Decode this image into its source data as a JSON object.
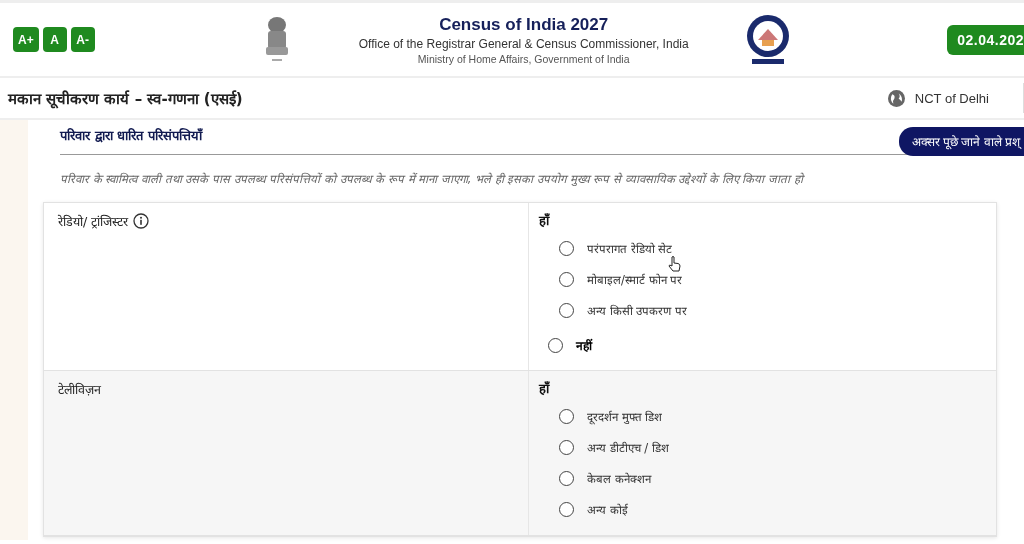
{
  "header": {
    "font_buttons": [
      "A+",
      "A",
      "A-"
    ],
    "title": "Census of India 2027",
    "subtitle": "Office of the Registrar General & Census Commissioner, India",
    "ministry": "Ministry of Home Affairs, Government of India",
    "date": "02.04.202"
  },
  "subheader": {
    "title": "मकान सूचीकरण कार्य – स्व-गणना (एसई)",
    "region": "NCT of Delhi"
  },
  "faq_button": "अक्सर पूछे जाने वाले प्रश्",
  "section": {
    "title": "परिवार द्वारा धारित परिसंपत्तियाँ",
    "description": "परिवार के स्वामित्व वाली तथा उसके पास उपलब्ध परिसंपत्तियों को उपलब्ध के रूप में माना जाएगा, भले ही इसका उपयोग मुख्य रूप से व्यावसायिक उद्देश्यों के लिए किया जाता हो"
  },
  "questions": [
    {
      "label": "रेडियो/ ट्रांजिस्टर",
      "info": true,
      "yes_label": "हाँ",
      "options": [
        {
          "label": "परंपरागत रेडियो सेट",
          "selected": false
        },
        {
          "label": "मोबाइल/स्मार्ट फोन पर",
          "selected": false
        },
        {
          "label": "अन्य किसी उपकरण पर",
          "selected": false
        }
      ],
      "no": {
        "label": "नहीं",
        "selected": false
      }
    },
    {
      "label": "टेलीविज़न",
      "info": false,
      "yes_label": "हाँ",
      "options": [
        {
          "label": "दूरदर्शन मुफ्त डिश",
          "selected": false
        },
        {
          "label": "अन्य डीटीएच / डिश",
          "selected": false
        },
        {
          "label": "केबल कनेक्शन",
          "selected": false
        },
        {
          "label": "अन्य कोई",
          "selected": false
        }
      ]
    }
  ]
}
